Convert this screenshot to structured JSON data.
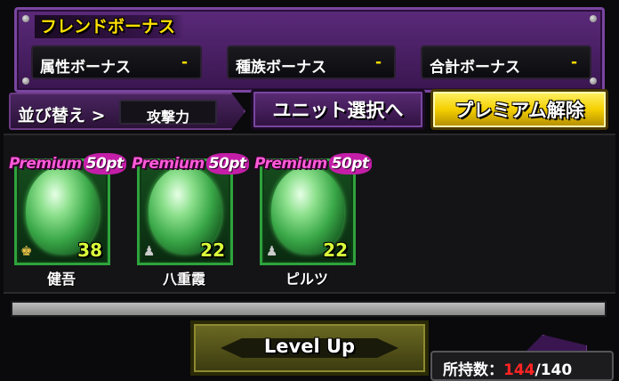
{
  "bonus_panel": {
    "title": "フレンドボーナス",
    "items": [
      {
        "label": "属性ボーナス",
        "value": "-"
      },
      {
        "label": "種族ボーナス",
        "value": "-"
      },
      {
        "label": "合計ボーナス",
        "value": "-"
      }
    ]
  },
  "sort": {
    "label": "並び替え >",
    "value": "攻撃力"
  },
  "buttons": {
    "unit_select": "ユニット選択へ",
    "premium_release": "プレミアム解除",
    "level_up": "Level Up"
  },
  "units": [
    {
      "name": "健吾",
      "level": "38",
      "premium_text": "Premium",
      "premium_cost": "50pt",
      "rank_icon": "crown-icon"
    },
    {
      "name": "八重霞",
      "level": "22",
      "premium_text": "Premium",
      "premium_cost": "50pt",
      "rank_icon": "chess-piece-icon"
    },
    {
      "name": "ピルツ",
      "level": "22",
      "premium_text": "Premium",
      "premium_cost": "50pt",
      "rank_icon": "chess-piece-icon"
    }
  ],
  "scrollbar": {
    "position_fraction": 1.0
  },
  "possession": {
    "label": "所持数：",
    "current": "144",
    "separator": "/",
    "max": "140"
  },
  "colors": {
    "accent_yellow": "#ffe000",
    "panel_purple": "#5b2a7a",
    "unit_green": "#2ea33c",
    "premium_pink": "#ff5ad8",
    "count_red": "#ff2424"
  }
}
